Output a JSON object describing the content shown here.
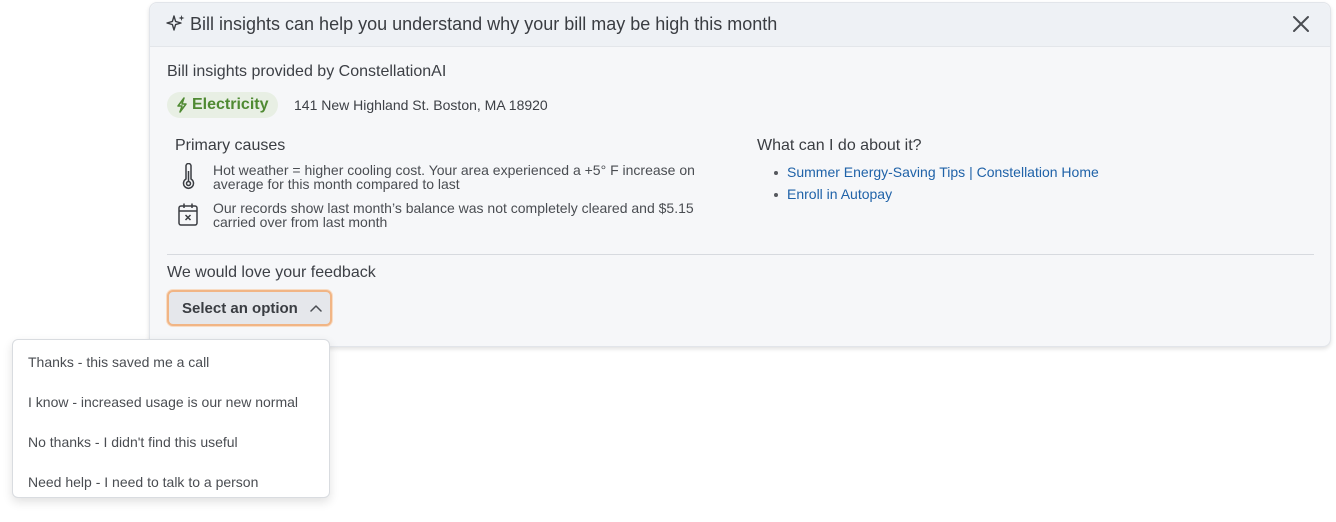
{
  "header": {
    "title": "Bill insights can help you understand why your bill may be high this month",
    "icon": "sparkle-icon",
    "close_icon": "close-icon"
  },
  "provided_by": "Bill insights provided by ConstellationAI",
  "utility": {
    "label": "Electricity",
    "icon": "lightning-bolt-icon",
    "address": "141 New Highland St. Boston, MA 18920"
  },
  "primary_causes": {
    "title": "Primary causes",
    "items": [
      {
        "icon": "thermometer-icon",
        "line1": "Hot weather = higher cooling cost. Your area experienced a +5° F increase on",
        "line2": "average for this month compared to last"
      },
      {
        "icon": "calendar-x-icon",
        "line1": "Our records show last month’s balance was not completely cleared and $5.15",
        "line2": "carried over from last month"
      }
    ]
  },
  "actions": {
    "title": "What can I do about it?",
    "links": [
      "Summer Energy-Saving Tips | Constellation Home",
      "Enroll in Autopay"
    ]
  },
  "feedback": {
    "label": "We would love your feedback",
    "select_label": "Select an option",
    "options": [
      "Thanks - this saved me a call",
      "I know - increased usage is our new normal",
      "No thanks - I didn't find this useful",
      "Need help - I need to talk to a person"
    ]
  },
  "colors": {
    "accent_green": "#4f8a32",
    "link_blue": "#1f62a8",
    "focus_orange": "#f1b585"
  }
}
